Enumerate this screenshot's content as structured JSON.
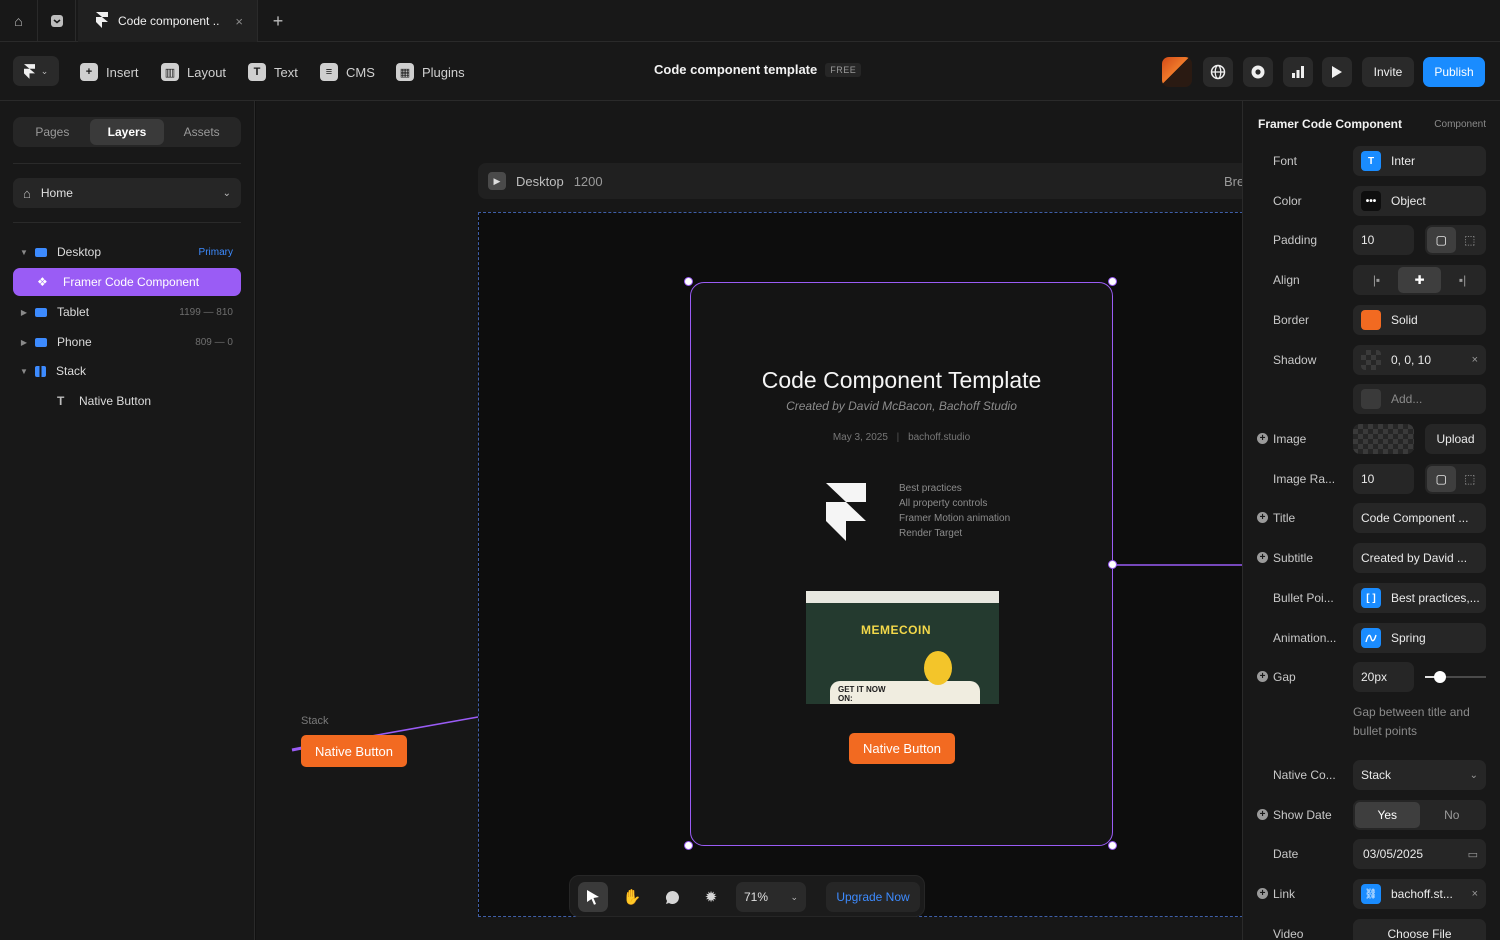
{
  "tab": {
    "title": "Code component ..",
    "close": "×",
    "add": "+"
  },
  "toolbar": {
    "items": [
      {
        "label": "Insert",
        "icon": "plus-icon"
      },
      {
        "label": "Layout",
        "icon": "layout-icon"
      },
      {
        "label": "Text",
        "icon": "text-icon"
      },
      {
        "label": "CMS",
        "icon": "database-icon"
      },
      {
        "label": "Plugins",
        "icon": "plugins-icon"
      }
    ],
    "project_title": "Code component template",
    "plan_badge": "FREE",
    "invite_label": "Invite",
    "publish_label": "Publish"
  },
  "left": {
    "segments": [
      "Pages",
      "Layers",
      "Assets"
    ],
    "active_segment": "Layers",
    "page": "Home",
    "layers": [
      {
        "label": "Desktop",
        "meta": "Primary"
      },
      {
        "label": "Framer Code Component",
        "meta": ""
      },
      {
        "label": "Tablet",
        "meta": "1199 — 810"
      },
      {
        "label": "Phone",
        "meta": "809 — 0"
      },
      {
        "label": "Stack",
        "meta": ""
      },
      {
        "label": "Native Button",
        "meta": ""
      }
    ]
  },
  "canvas": {
    "frame_name": "Desktop",
    "frame_width": "1200",
    "breakpoint_partial": "Bre",
    "card": {
      "title": "Code Component Template",
      "subtitle": "Created by David McBacon, Bachoff Studio",
      "date": "May 3, 2025",
      "separator": "|",
      "site": "bachoff.studio",
      "bullets": [
        "Best practices",
        "All property controls",
        "Framer Motion animation",
        "Render Target"
      ],
      "thumb_title": "MEMECOIN",
      "thumb_cta": "GET IT NOW ON:",
      "button": "Native Button"
    },
    "stack_label": "Stack",
    "stack_button": "Native Button",
    "zoom": "71%",
    "upgrade": "Upgrade Now"
  },
  "right": {
    "title": "Framer Code Component",
    "kind": "Component",
    "font_label": "Font",
    "font_value": "Inter",
    "color_label": "Color",
    "color_value": "Object",
    "padding_label": "Padding",
    "padding_value": "10",
    "align_label": "Align",
    "border_label": "Border",
    "border_value": "Solid",
    "border_color": "#f26a21",
    "shadow_label": "Shadow",
    "shadow_value": "0, 0, 10",
    "add_label": "Add...",
    "image_label": "Image",
    "upload_label": "Upload",
    "image_radius_label": "Image Ra...",
    "image_radius_value": "10",
    "title_label": "Title",
    "title_value": "Code Component ...",
    "subtitle_label": "Subtitle",
    "subtitle_value": "Created by David ...",
    "bullets_label": "Bullet Poi...",
    "bullets_value": "Best practices,...",
    "animation_label": "Animation...",
    "animation_value": "Spring",
    "gap_label": "Gap",
    "gap_value": "20px",
    "gap_level": 0.25,
    "gap_hint": "Gap between title and bullet points",
    "native_label": "Native Co...",
    "native_value": "Stack",
    "showdate_label": "Show Date",
    "showdate_yes": "Yes",
    "showdate_no": "No",
    "date_label": "Date",
    "date_value": "03/05/2025",
    "link_label": "Link",
    "link_value": "bachoff.st...",
    "video_label": "Video",
    "video_value": "Choose File",
    "clear": "×",
    "accent": "#1a8cff",
    "selection": "#9a5cf5"
  }
}
